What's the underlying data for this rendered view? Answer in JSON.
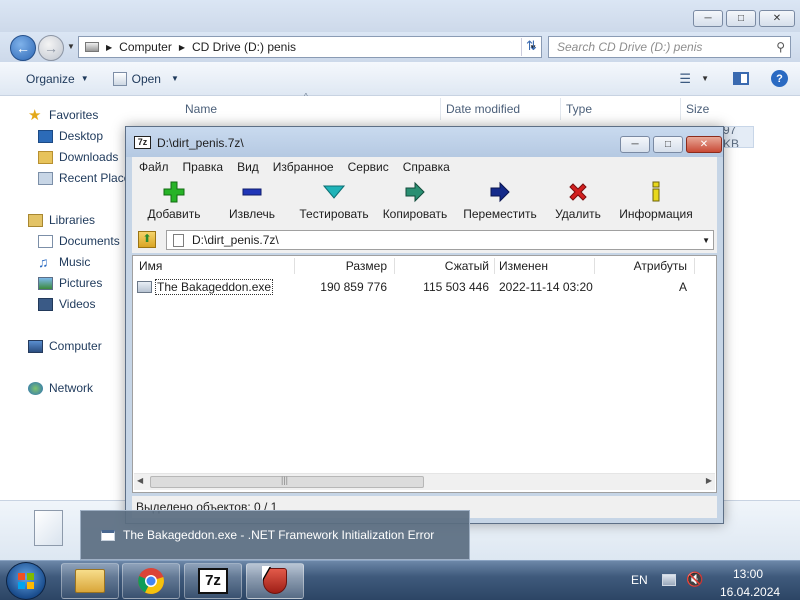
{
  "explorer": {
    "address": {
      "computer": "Computer",
      "drive": "CD Drive (D:) penis"
    },
    "search_placeholder": "Search CD Drive (D:) penis",
    "toolbar": {
      "organize": "Organize",
      "open": "Open"
    },
    "sidebar": {
      "favorites": "Favorites",
      "desktop": "Desktop",
      "downloads": "Downloads",
      "recent": "Recent Place",
      "libraries": "Libraries",
      "documents": "Documents",
      "music": "Music",
      "pictures": "Pictures",
      "videos": "Videos",
      "computer": "Computer",
      "network": "Network"
    },
    "columns": {
      "name": "Name",
      "date": "Date modified",
      "type": "Type",
      "size": "Size"
    },
    "size_partial": "97 KB"
  },
  "sevenzip": {
    "title": "D:\\dirt_penis.7z\\",
    "menu": [
      "Файл",
      "Правка",
      "Вид",
      "Избранное",
      "Сервис",
      "Справка"
    ],
    "tools": {
      "add": "Добавить",
      "extract": "Извлечь",
      "test": "Тестировать",
      "copy": "Копировать",
      "move": "Переместить",
      "delete": "Удалить",
      "info": "Информация"
    },
    "path": "D:\\dirt_penis.7z\\",
    "columns": {
      "name": "Имя",
      "size": "Размер",
      "packed": "Сжатый",
      "modified": "Изменен",
      "attributes": "Атрибуты"
    },
    "row": {
      "name": "The Bakageddon.exe",
      "size": "190 859 776",
      "packed": "115 503 446",
      "modified": "2022-11-14 03:20",
      "attributes": "A"
    },
    "status": "Выделено объектов: 0 / 1"
  },
  "popup": {
    "text": "The Bakageddon.exe - .NET Framework Initialization Error"
  },
  "tray": {
    "lang": "EN",
    "time": "13:00",
    "date": "16.04.2024"
  },
  "taskbar": {
    "sevenzip_label": "7z"
  }
}
